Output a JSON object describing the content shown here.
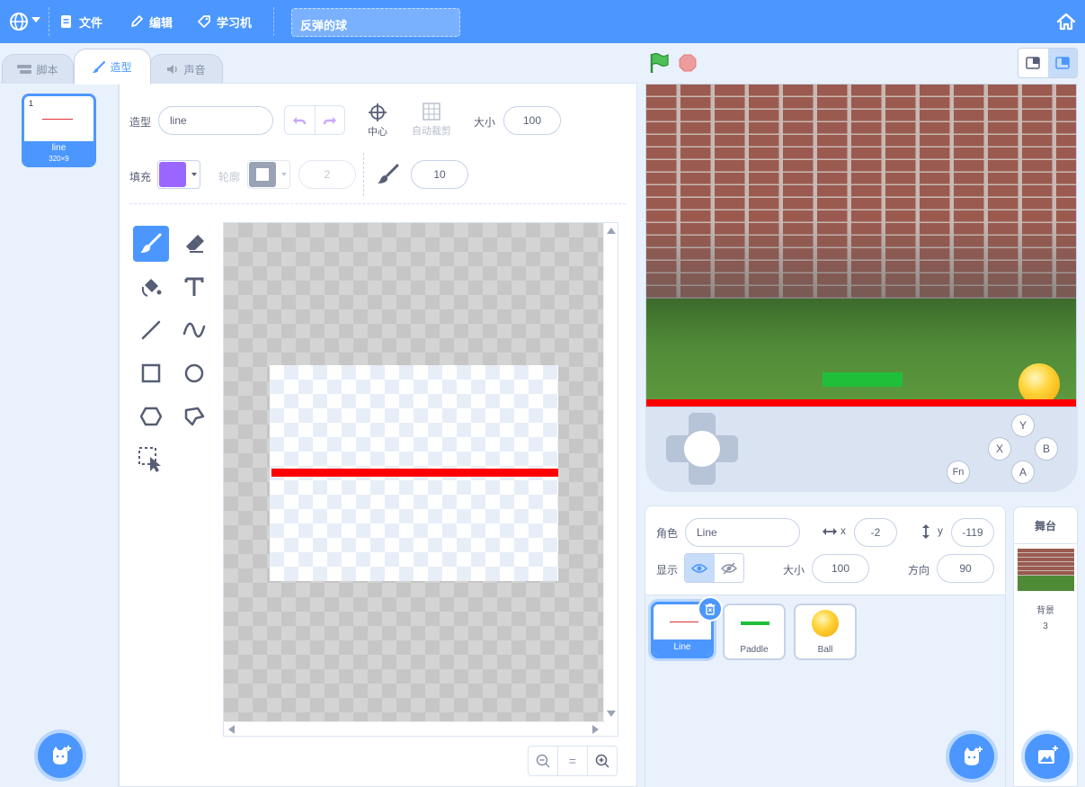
{
  "menubar": {
    "file": "文件",
    "edit": "编辑",
    "learning": "学习机",
    "project_title": "反弹的球"
  },
  "tabs": {
    "code": "脚本",
    "costumes": "造型",
    "sounds": "声音"
  },
  "costume_list": [
    {
      "number": "1",
      "name": "line",
      "size": "320×9"
    }
  ],
  "paint": {
    "costume_label": "造型",
    "costume_name": "line",
    "center_label": "中心",
    "auto_crop_label": "自动裁剪",
    "size_label": "大小",
    "size_value": "100",
    "fill_label": "填充",
    "fill_color": "#9966ff",
    "outline_label": "轮廓",
    "outline_width": "2",
    "brush_size": "10",
    "zoom_reset": "="
  },
  "stage": {
    "line_color": "#ff0000",
    "paddle_color": "#1fbf3a",
    "ball_color": "#ffd43b"
  },
  "gamepad": {
    "buttons": {
      "y": "Y",
      "x": "X",
      "b": "B",
      "a": "A",
      "fn": "Fn"
    }
  },
  "sprite_info": {
    "sprite_label": "角色",
    "sprite_name": "Line",
    "x_label": "x",
    "x_value": "-2",
    "y_label": "y",
    "y_value": "-119",
    "show_label": "显示",
    "size_label": "大小",
    "size_value": "100",
    "direction_label": "方向",
    "direction_value": "90"
  },
  "sprites": [
    {
      "name": "Line"
    },
    {
      "name": "Paddle"
    },
    {
      "name": "Ball"
    }
  ],
  "stage_pane": {
    "title": "舞台",
    "backdrops_label": "背景",
    "backdrops_count": "3"
  }
}
